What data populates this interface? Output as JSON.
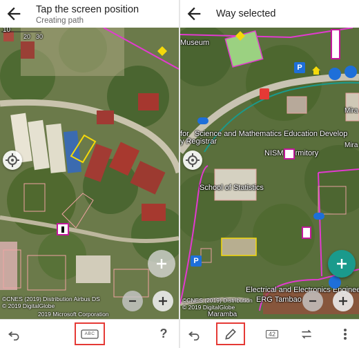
{
  "left": {
    "appbar": {
      "title": "Tap the screen position",
      "subtitle": "Creating path"
    },
    "scale": {
      "major": "10",
      "minor": "20",
      "minor2": "30"
    },
    "attribution": {
      "line1": "©CNES (2019) Distribution Airbus DS",
      "line2": "© 2019 DigitalGlobe",
      "line3": "© 2019 Microsoft Corporation",
      "line3_visible": "2019 Microsoft Corporation"
    },
    "toolbar": {
      "help_label": "?",
      "abc_label": "ABC"
    }
  },
  "right": {
    "appbar": {
      "title": "Way selected"
    },
    "labels": {
      "museum": "Museum",
      "dev": "Science and Mathematics Education Develop",
      "dev_prefix": "for",
      "registrar": "y Registrar",
      "dormitory": "NISM Dormitory",
      "school": "School of Statistics",
      "electrical": "Electrical and Electronics Engineering",
      "tambaa": "ERG Tambao",
      "maramba": "Maramba",
      "mira1": "Mira",
      "mira2": "Mira"
    },
    "attribution": {
      "line1": "©CNES (2019) Distribution",
      "line2": "© 2019 DigitalGlobe"
    },
    "toolbar": {
      "count_badge": "42"
    }
  },
  "colors": {
    "accent_teal": "#1a9a8c",
    "highlight_red": "#e53935",
    "poi_magenta": "#c2179b",
    "path_yellow": "#f5d90a",
    "parking_blue": "#1e6fd9"
  }
}
